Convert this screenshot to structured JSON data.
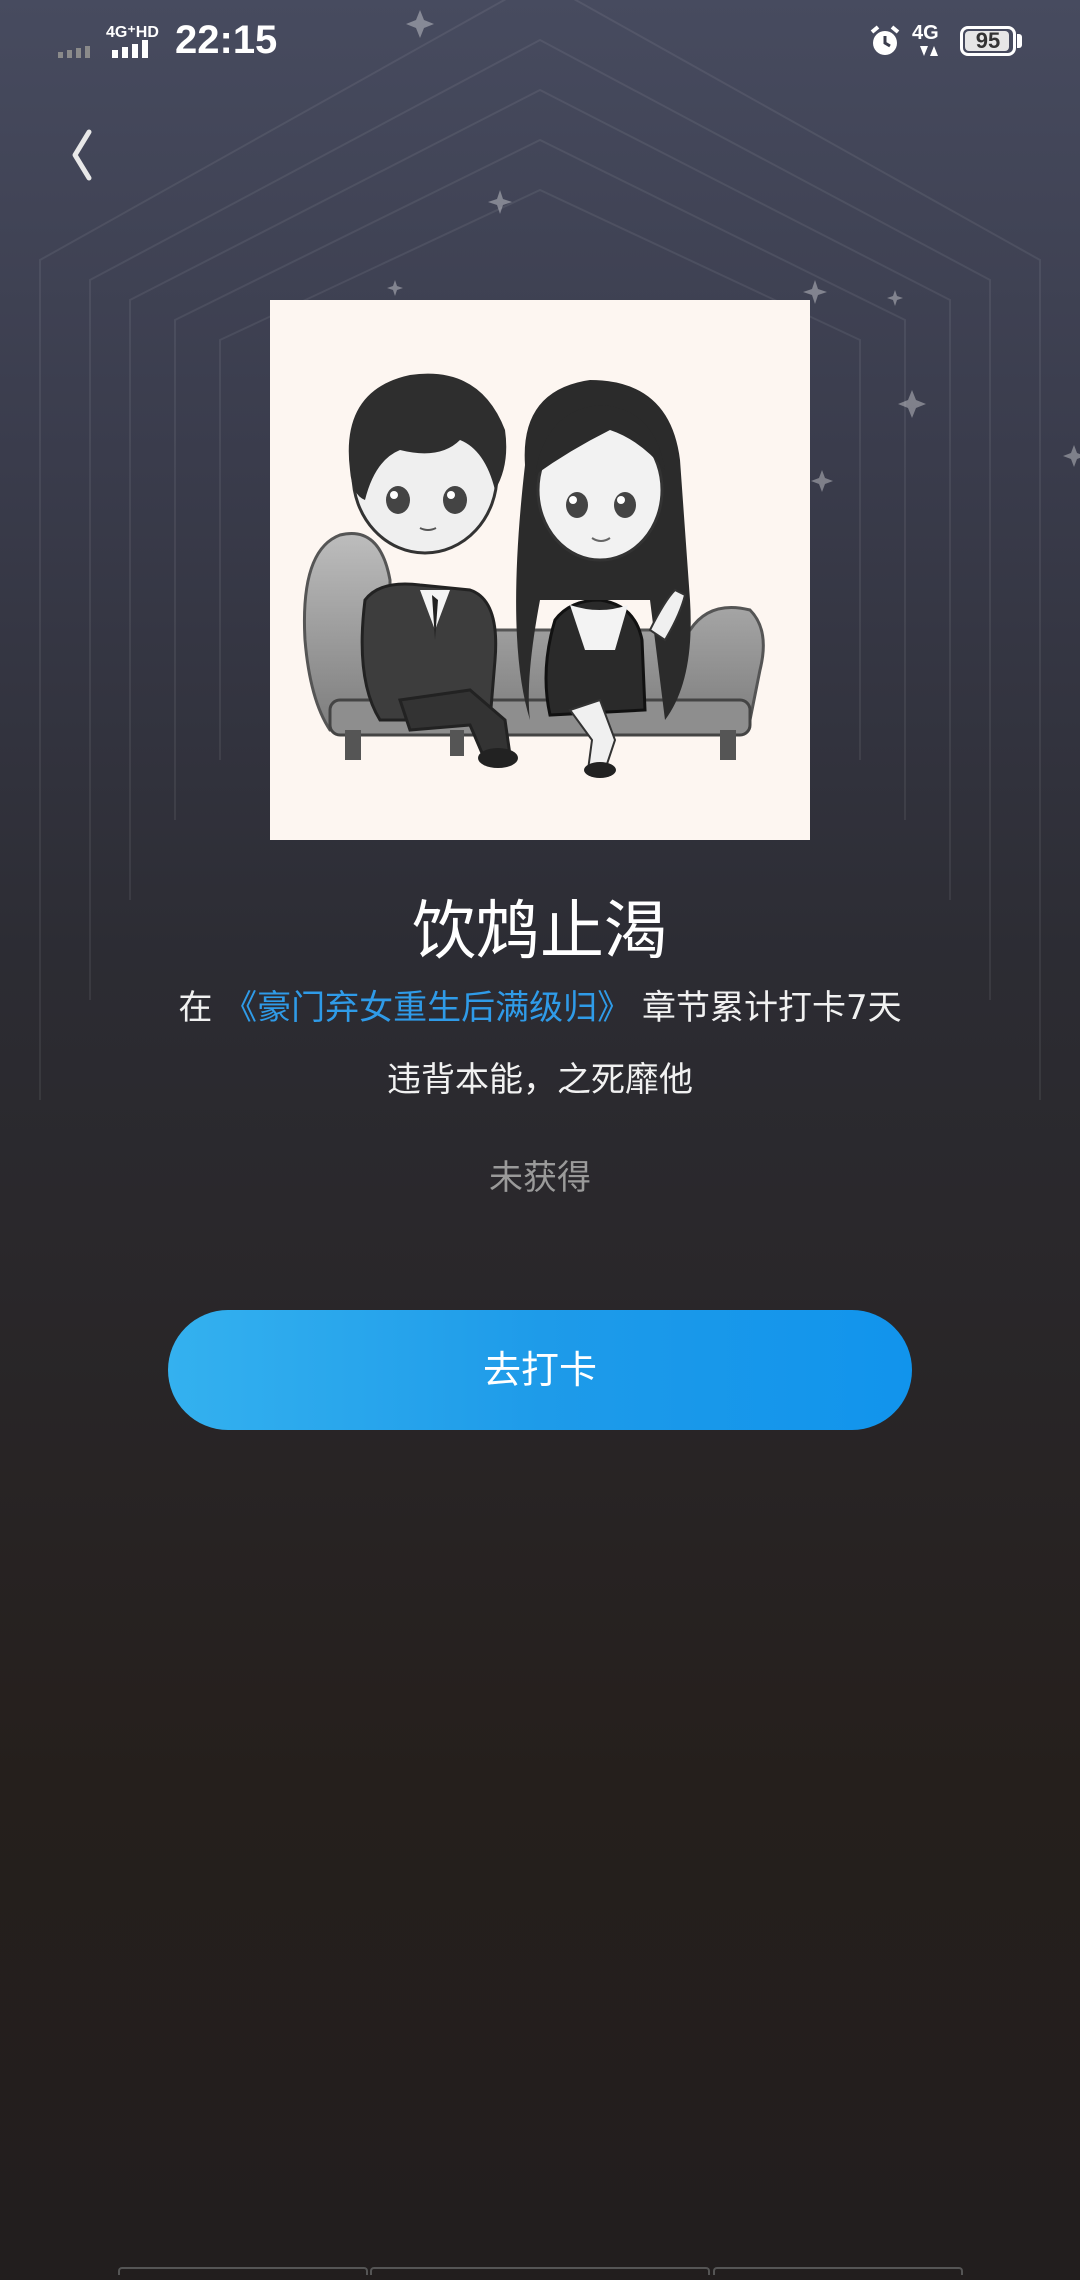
{
  "status_bar": {
    "time": "22:15",
    "network_left": "4G⁺HD",
    "network_right": "4G",
    "battery": "95",
    "battery_level": 0.95,
    "icons": [
      "signal-weak-icon",
      "signal-4g-icon",
      "alarm-icon",
      "signal-4g-icon",
      "battery-icon"
    ]
  },
  "header": {
    "back_icon": "chevron-left-icon"
  },
  "badge": {
    "title": "饮鸩止渴",
    "desc_prefix": "在",
    "book_title": "《豪门弃女重生后满级归》",
    "desc_suffix": "章节累计打卡7天",
    "quote": "违背本能，之死靡他",
    "status": "未获得"
  },
  "actions": {
    "checkin_label": "去打卡"
  },
  "colors": {
    "accent": "#2f9be8",
    "button_start": "#34b1ef",
    "button_end": "#1194ec",
    "muted": "#9a9a9a"
  }
}
